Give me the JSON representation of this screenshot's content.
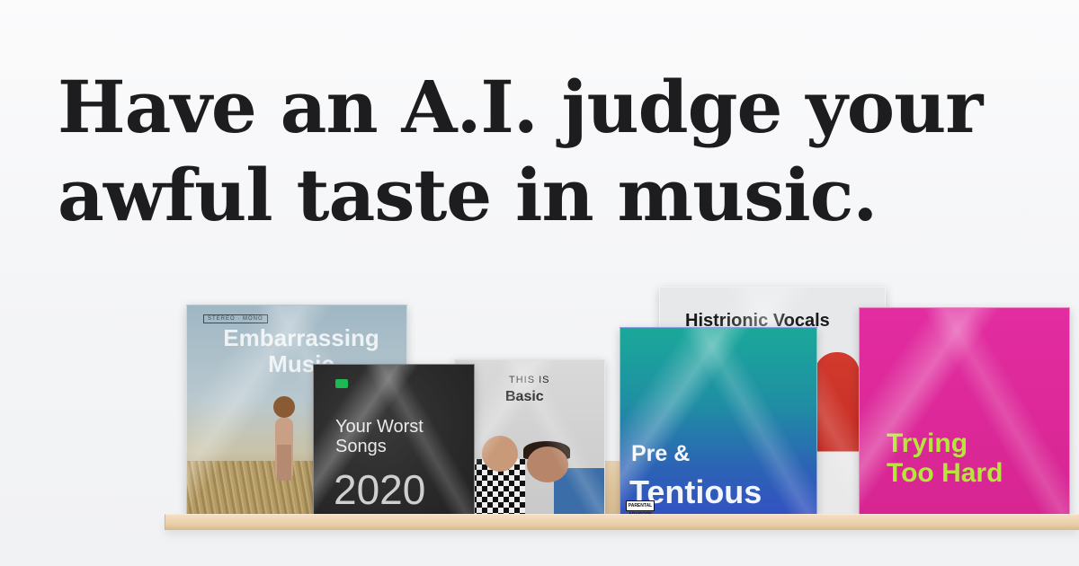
{
  "headline": {
    "line1": "Have an A.I. judge your",
    "line2": "awful taste in music."
  },
  "records": {
    "embarrassing": {
      "tag": "STEREO · MONO",
      "title": "Embarrassing Music"
    },
    "worst": {
      "title_line1": "Your Worst",
      "title_line2": "Songs",
      "year": "2020"
    },
    "basic": {
      "kicker": "THIS IS",
      "title": "Basic"
    },
    "histrionic": {
      "title": "Histrionic Vocals"
    },
    "pre": {
      "line1": "Pre &",
      "line2": "Tentious",
      "advisory": "PARENTAL ADVISORY"
    },
    "trying": {
      "line1": "Trying",
      "line2": "Too Hard"
    }
  },
  "colors": {
    "background": "#f3f4f6",
    "headline": "#1d1d1f",
    "spotify_green": "#1db954",
    "pre_gradient_top": "#1aa89a",
    "pre_gradient_bottom": "#3352c2",
    "trying_bg": "#e22ca0",
    "trying_text": "#b7e53d",
    "shelf": "#e9cfa8"
  }
}
